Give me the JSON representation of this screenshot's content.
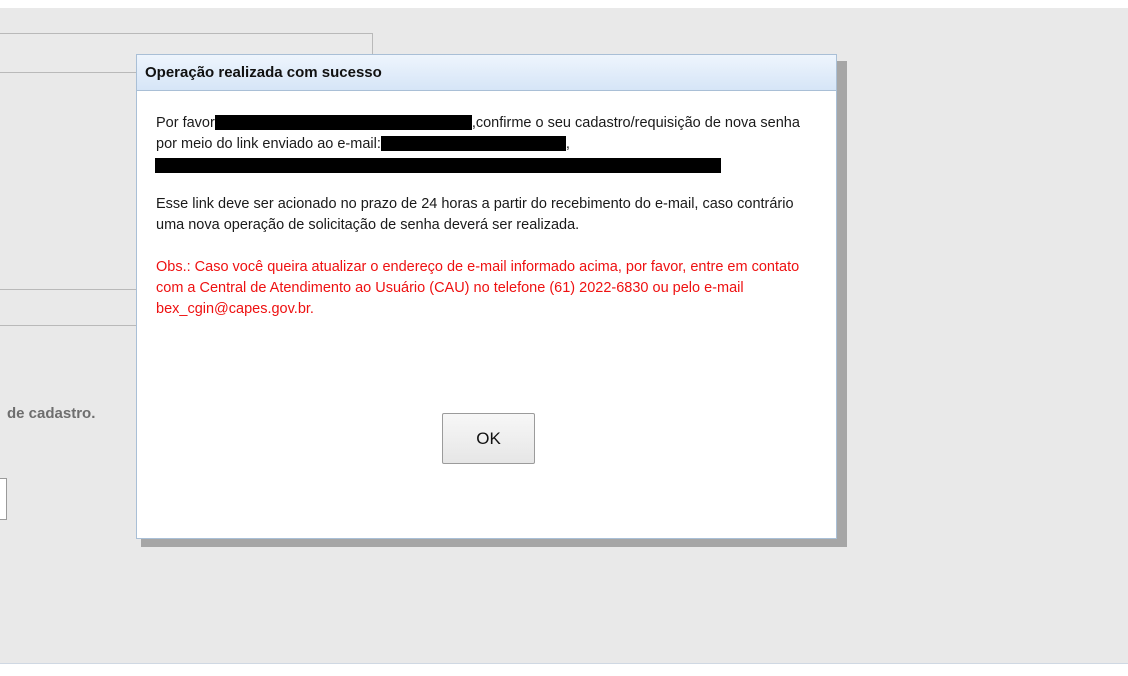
{
  "background": {
    "partial_text": "de cadastro."
  },
  "dialog": {
    "title": "Operação realizada com sucesso",
    "para1": {
      "part1": "Por favor",
      "part2": ",confirme o seu cadastro/requisição de nova senha por meio do link enviado ao e-mail:",
      "part3": ","
    },
    "para2": "Esse link deve ser acionado no prazo de 24 horas a partir do recebimento do e-mail, caso contrário uma nova operação de solicitação de senha deverá ser realizada.",
    "para3": "Obs.: Caso você queira atualizar o endereço de e-mail informado acima, por favor, entre em contato com a Central de Atendimento ao Usuário (CAU) no telefone (61) 2022-6830 ou pelo e-mail bex_cgin@capes.gov.br.",
    "ok_label": "OK"
  },
  "colors": {
    "warning_text": "#ee1111",
    "titlebar": "#d6e5f7",
    "overlay": "#e9e9e9"
  }
}
